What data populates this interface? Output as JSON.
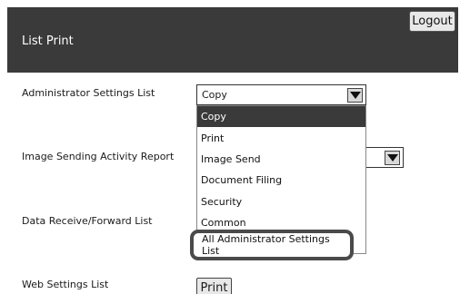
{
  "header": {
    "title": "List Print",
    "logout_label": "Logout"
  },
  "rows": {
    "admin_settings": {
      "label": "Administrator Settings List",
      "selected": "Copy"
    },
    "image_sending": {
      "label": "Image Sending Activity Report",
      "partial_value": ":)"
    },
    "data_receive": {
      "label": "Data Receive/Forward List"
    },
    "web_settings": {
      "label": "Web Settings List",
      "print_label": "Print"
    }
  },
  "dropdown": {
    "items": [
      "Copy",
      "Print",
      "Image Send",
      "Document Filing",
      "Security",
      "Common"
    ],
    "highlighted": "All Administrator Settings List"
  },
  "colors": {
    "header_bg": "#3a3a3a",
    "selected_bg": "#3a3a3a",
    "highlight_border": "#4a4a4a"
  }
}
